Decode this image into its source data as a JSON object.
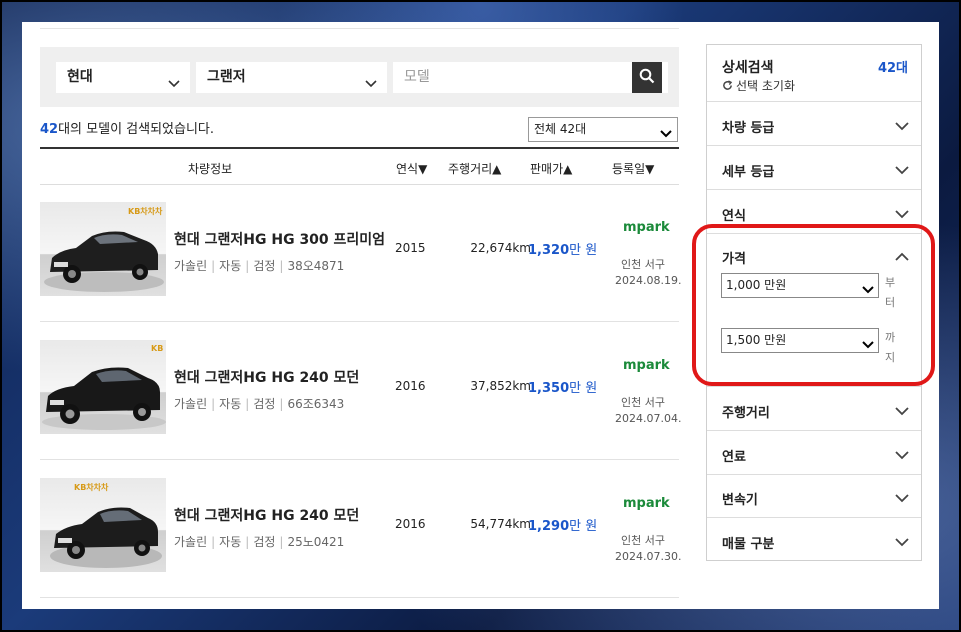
{
  "search": {
    "maker": "현대",
    "model": "그랜저",
    "sub_model_placeholder": "모델"
  },
  "results": {
    "count": "42",
    "count_text": "대의 모델이 검색되었습니다.",
    "filter_value": "전체 42대"
  },
  "table": {
    "headers": {
      "info": "차량정보",
      "year": "연식▼",
      "mileage": "주행거리▲",
      "price": "판매가▲",
      "date": "등록일▼"
    }
  },
  "listings": [
    {
      "thumb_badge": "KB차차차",
      "title": "현대 그랜저HG HG 300 프리미엄",
      "fuel": "가솔린",
      "transmission": "자동",
      "color": "검정",
      "plate": "38오4871",
      "year": "2015",
      "mileage": "22,674km",
      "price": "1,320",
      "price_unit": "만 원",
      "dealer": "mpark",
      "location": "인천 서구",
      "date": "2024.08.19."
    },
    {
      "thumb_badge": "KB",
      "title": "현대 그랜저HG HG 240 모던",
      "fuel": "가솔린",
      "transmission": "자동",
      "color": "검정",
      "plate": "66조6343",
      "year": "2016",
      "mileage": "37,852km",
      "price": "1,350",
      "price_unit": "만 원",
      "dealer": "mpark",
      "location": "인천 서구",
      "date": "2024.07.04."
    },
    {
      "thumb_badge": "KB차차차",
      "title": "현대 그랜저HG HG 240 모던",
      "fuel": "가솔린",
      "transmission": "자동",
      "color": "검정",
      "plate": "25노0421",
      "year": "2016",
      "mileage": "54,774km",
      "price": "1,290",
      "price_unit": "만 원",
      "dealer": "mpark",
      "location": "인천 서구",
      "date": "2024.07.30."
    }
  ],
  "sidebar": {
    "title": "상세검색",
    "count": "42대",
    "reset": "선택 초기화",
    "items": [
      "차량 등급",
      "세부 등급",
      "연식",
      "가격",
      "주행거리",
      "연료",
      "변속기",
      "매물 구분"
    ],
    "price": {
      "min": "1,000 만원",
      "min_suffix": "부터",
      "max": "1,500 만원",
      "max_suffix": "까지"
    }
  },
  "colors": {
    "accent": "#1a56c9",
    "dealer": "#1b8a3a",
    "highlight": "#e01818"
  }
}
